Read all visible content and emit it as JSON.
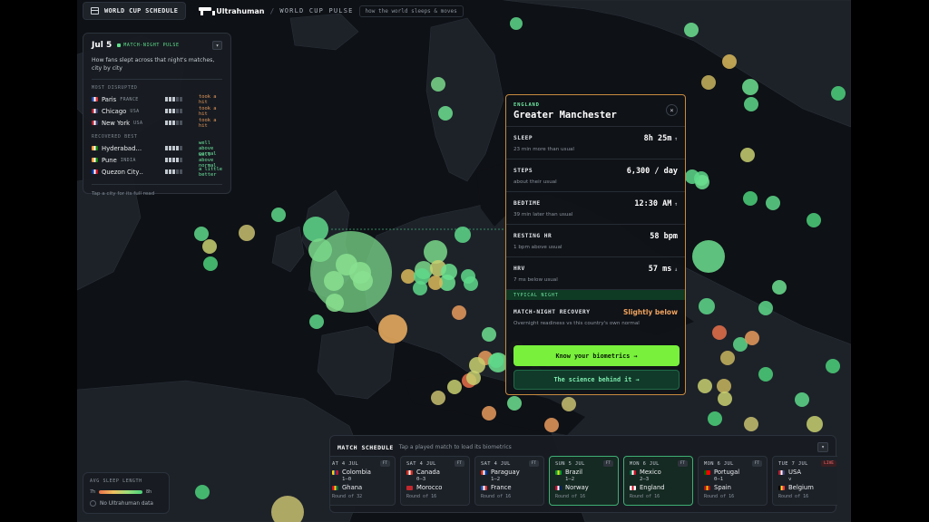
{
  "topbar": {
    "schedule_label": "WORLD CUP SCHEDULE",
    "brand": "Ultrahuman",
    "separator": "/",
    "title": "WORLD CUP PULSE",
    "tagline": "how the world sleeps & moves"
  },
  "night_panel": {
    "date": "Jul 5",
    "badge": "MATCH-NIGHT PULSE",
    "collapse": "▾",
    "description": "How fans slept across that night's matches, city by city",
    "disrupted_title": "MOST DISRUPTED",
    "recovered_title": "RECOVERED BEST",
    "disrupted": [
      {
        "city": "Paris",
        "country": "FRANCE",
        "level": 3,
        "status": "took a hit",
        "flag": [
          "#2d4fb0",
          "#ffffff",
          "#d8343a"
        ]
      },
      {
        "city": "Chicago",
        "country": "USA",
        "level": 3,
        "status": "took a hit",
        "flag": [
          "#b22234",
          "#ffffff",
          "#3c3b6e"
        ]
      },
      {
        "city": "New York",
        "country": "USA",
        "level": 3,
        "status": "took a hit",
        "flag": [
          "#b22234",
          "#ffffff",
          "#3c3b6e"
        ]
      }
    ],
    "recovered": [
      {
        "city": "Hyderabad…",
        "country": "",
        "level": 4,
        "status": "well above normal",
        "flag": [
          "#ff9933",
          "#ffffff",
          "#138808"
        ]
      },
      {
        "city": "Pune",
        "country": "INDIA",
        "level": 4,
        "status": "well above normal",
        "flag": [
          "#ff9933",
          "#ffffff",
          "#138808"
        ]
      },
      {
        "city": "Quezon City…",
        "country": "",
        "level": 3,
        "status": "a little better",
        "flag": [
          "#0038a8",
          "#ffffff",
          "#ce1126"
        ]
      }
    ],
    "footer": "Tap a city for its full read"
  },
  "city_card": {
    "country": "ENGLAND",
    "city": "Greater Manchester",
    "close": "×",
    "metrics": [
      {
        "label": "SLEEP",
        "value": "8h 25m",
        "arrow": "↑",
        "sub": "23 min more than usual"
      },
      {
        "label": "STEPS",
        "value": "6,300 / day",
        "arrow": "",
        "sub": "about their usual"
      },
      {
        "label": "BEDTIME",
        "value": "12:30 AM",
        "arrow": "↑",
        "sub": "39 min later than usual"
      },
      {
        "label": "RESTING HR",
        "value": "58 bpm",
        "arrow": "",
        "sub": "1 bpm above usual"
      },
      {
        "label": "HRV",
        "value": "57 ms",
        "arrow": "↓",
        "sub": "7 ms below usual"
      }
    ],
    "typical_label": "TYPICAL NIGHT",
    "recovery_label": "MATCH-NIGHT RECOVERY",
    "recovery_value": "Slightly below",
    "recovery_sub": "Overnight readiness vs this country's own normal",
    "primary_button": "Know your biometrics →",
    "secondary_button": "The science behind it →"
  },
  "schedule": {
    "title": "MATCH SCHEDULE",
    "hint": "Tap a played match to load its biometrics",
    "collapse": "▾",
    "matches": [
      {
        "date": "AT 4 JUL",
        "badge": "FT",
        "home": "Colombia",
        "away": "Ghana",
        "score": "1–0",
        "round": "Round of 32",
        "hflag": [
          "#fcd116",
          "#003893",
          "#ce1126"
        ],
        "aflag": [
          "#ce1126",
          "#fcd116",
          "#006b3f"
        ],
        "selected": false,
        "live": false
      },
      {
        "date": "SAT 4 JUL",
        "badge": "FT",
        "home": "Canada",
        "away": "Morocco",
        "score": "0–3",
        "round": "Round of 16",
        "hflag": [
          "#d52b1e",
          "#ffffff",
          "#d52b1e"
        ],
        "aflag": [
          "#c1272d",
          "#c1272d",
          "#c1272d"
        ],
        "selected": false,
        "live": false
      },
      {
        "date": "SAT 4 JUL",
        "badge": "FT",
        "home": "Paraguay",
        "away": "France",
        "score": "1–2",
        "round": "Round of 16",
        "hflag": [
          "#d52b1e",
          "#ffffff",
          "#0038a8"
        ],
        "aflag": [
          "#2d4fb0",
          "#ffffff",
          "#d8343a"
        ],
        "selected": false,
        "live": false
      },
      {
        "date": "SUN 5 JUL",
        "badge": "FT",
        "home": "Brazil",
        "away": "Norway",
        "score": "1–2",
        "round": "Round of 16",
        "hflag": [
          "#009c3b",
          "#ffdf00",
          "#009c3b"
        ],
        "aflag": [
          "#ba0c2f",
          "#ffffff",
          "#00205b"
        ],
        "selected": true,
        "live": false
      },
      {
        "date": "MON 6 JUL",
        "badge": "FT",
        "home": "Mexico",
        "away": "England",
        "score": "2–3",
        "round": "Round of 16",
        "hflag": [
          "#006847",
          "#ffffff",
          "#ce1126"
        ],
        "aflag": [
          "#ffffff",
          "#ce1124",
          "#ffffff"
        ],
        "selected": true,
        "live": false
      },
      {
        "date": "MON 6 JUL",
        "badge": "FT",
        "home": "Portugal",
        "away": "Spain",
        "score": "0–1",
        "round": "Round of 16",
        "hflag": [
          "#006600",
          "#ff0000",
          "#ff0000"
        ],
        "aflag": [
          "#aa151b",
          "#f1bf00",
          "#aa151b"
        ],
        "selected": false,
        "live": false
      },
      {
        "date": "TUE 7 JUL",
        "badge": "LIVE",
        "home": "USA",
        "away": "Belgium",
        "score": "v",
        "round": "Round of 16",
        "hflag": [
          "#b22234",
          "#ffffff",
          "#3c3b6e"
        ],
        "aflag": [
          "#000000",
          "#fdda24",
          "#ef3340"
        ],
        "selected": false,
        "live": true
      }
    ]
  },
  "legend": {
    "title": "AVG SLEEP LENGTH",
    "min": "7h",
    "max": "8h",
    "none": "No Ultrahuman data"
  },
  "colors": {
    "accent_green": "#78f03c",
    "recovery_orange": "#f0a35e",
    "card_border": "#c78a3e"
  }
}
